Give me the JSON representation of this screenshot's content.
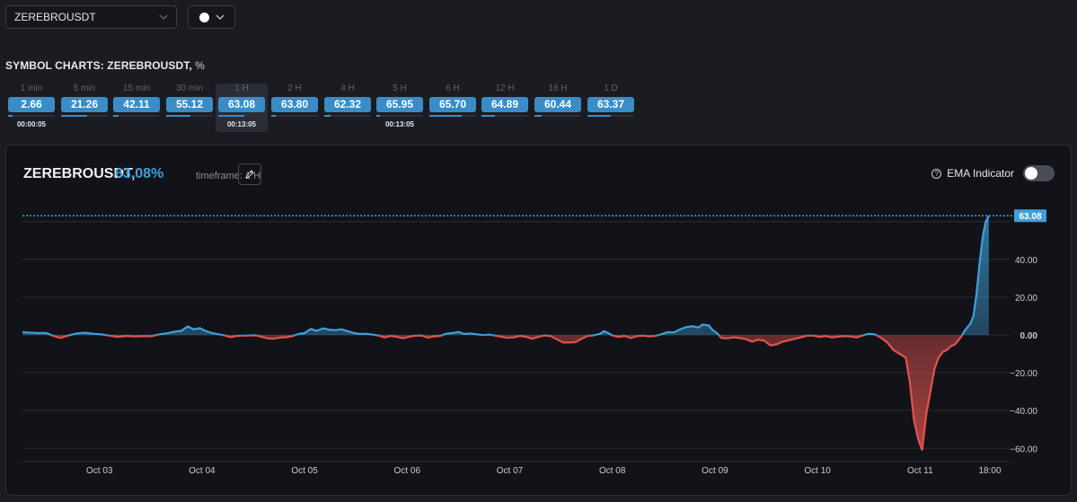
{
  "symbol_select": {
    "value": "ZEREBROUSDT"
  },
  "section": {
    "title": "SYMBOL CHARTS: ZEREBROUSDT,",
    "unit": "%"
  },
  "timeframes": [
    {
      "label": "1 min",
      "value": "2.66",
      "fill": 0.1,
      "timer": "00:00:05",
      "active": false
    },
    {
      "label": "5 min",
      "value": "21.26",
      "fill": 0.55,
      "timer": "",
      "active": false
    },
    {
      "label": "15 min",
      "value": "42.11",
      "fill": 0.12,
      "timer": "",
      "active": false
    },
    {
      "label": "30 min",
      "value": "55.12",
      "fill": 0.52,
      "timer": "",
      "active": false
    },
    {
      "label": "1 H",
      "value": "63.08",
      "fill": 0.55,
      "timer": "00:13:05",
      "active": true
    },
    {
      "label": "2 H",
      "value": "63.80",
      "fill": 0.1,
      "timer": "",
      "active": false
    },
    {
      "label": "4 H",
      "value": "62.32",
      "fill": 0.14,
      "timer": "",
      "active": false
    },
    {
      "label": "5 H",
      "value": "65.95",
      "fill": 0.08,
      "timer": "00:13:05",
      "active": false
    },
    {
      "label": "6 H",
      "value": "65.70",
      "fill": 0.7,
      "timer": "",
      "active": false
    },
    {
      "label": "12 H",
      "value": "64.89",
      "fill": 0.28,
      "timer": "",
      "active": false
    },
    {
      "label": "16 H",
      "value": "60.44",
      "fill": 0.16,
      "timer": "",
      "active": false
    },
    {
      "label": "1 D",
      "value": "63.37",
      "fill": 0.5,
      "timer": "",
      "active": false
    }
  ],
  "panel": {
    "symbol": "ZEREBROUSDT,",
    "value": "63.08%",
    "timeframe": "timeframe: 1 H",
    "ema_label": "EMA Indicator",
    "ema_on": false
  },
  "icons": {
    "chevron": "chevron-down-icon",
    "pencil": "pencil-icon",
    "help": "help-icon"
  },
  "colors": {
    "positive": "#3ea0dc",
    "negative": "#e0534f",
    "accent": "#3a8cc6"
  },
  "chart_data": {
    "type": "area",
    "ylim": [
      -67,
      67
    ],
    "ytick_values": [
      40,
      20,
      0,
      -20,
      -40,
      -60
    ],
    "ytick_labels": [
      "40.00",
      "20.00",
      "0.00",
      "−20.00",
      "−40.00",
      "−60.00"
    ],
    "xlim": [
      2.25,
      11.75
    ],
    "xticks": [
      3,
      4,
      5,
      6,
      7,
      8,
      9,
      10,
      11,
      11.68
    ],
    "xtick_labels": [
      "Oct 03",
      "Oct 04",
      "Oct 05",
      "Oct 06",
      "Oct 07",
      "Oct 08",
      "Oct 09",
      "Oct 10",
      "Oct 11",
      "18:00"
    ],
    "last_value": 63.08,
    "last_label": "63.08",
    "series": [
      {
        "values": [
          [
            2.25,
            1.5
          ],
          [
            2.33,
            1.2
          ],
          [
            2.41,
            1.0
          ],
          [
            2.48,
            1.1
          ],
          [
            2.55,
            -0.5
          ],
          [
            2.62,
            -1.5
          ],
          [
            2.7,
            -0.3
          ],
          [
            2.78,
            0.8
          ],
          [
            2.86,
            1.2
          ],
          [
            2.94,
            0.6
          ],
          [
            3.02,
            0.3
          ],
          [
            3.1,
            -0.4
          ],
          [
            3.18,
            -1.0
          ],
          [
            3.26,
            -0.5
          ],
          [
            3.34,
            -0.8
          ],
          [
            3.42,
            -0.6
          ],
          [
            3.5,
            -0.7
          ],
          [
            3.58,
            0.3
          ],
          [
            3.66,
            0.9
          ],
          [
            3.74,
            1.8
          ],
          [
            3.8,
            2.2
          ],
          [
            3.86,
            4.5
          ],
          [
            3.92,
            3.0
          ],
          [
            3.98,
            3.6
          ],
          [
            4.04,
            2.0
          ],
          [
            4.1,
            1.0
          ],
          [
            4.16,
            0.4
          ],
          [
            4.22,
            -0.3
          ],
          [
            4.28,
            -1.2
          ],
          [
            4.34,
            -0.5
          ],
          [
            4.4,
            -0.4
          ],
          [
            4.46,
            -0.3
          ],
          [
            4.52,
            -0.2
          ],
          [
            4.58,
            -1.0
          ],
          [
            4.64,
            -1.8
          ],
          [
            4.7,
            -2.0
          ],
          [
            4.76,
            -1.4
          ],
          [
            4.82,
            -1.2
          ],
          [
            4.88,
            -0.6
          ],
          [
            4.94,
            0.5
          ],
          [
            5.0,
            1.0
          ],
          [
            5.06,
            3.2
          ],
          [
            5.12,
            2.2
          ],
          [
            5.18,
            3.5
          ],
          [
            5.24,
            2.8
          ],
          [
            5.3,
            2.5
          ],
          [
            5.36,
            3.0
          ],
          [
            5.42,
            2.0
          ],
          [
            5.48,
            1.0
          ],
          [
            5.54,
            0.5
          ],
          [
            5.6,
            0.6
          ],
          [
            5.66,
            0.2
          ],
          [
            5.72,
            -0.3
          ],
          [
            5.78,
            -1.3
          ],
          [
            5.84,
            -0.5
          ],
          [
            5.9,
            -1.0
          ],
          [
            5.96,
            -1.7
          ],
          [
            6.02,
            -1.0
          ],
          [
            6.08,
            -0.4
          ],
          [
            6.14,
            -0.3
          ],
          [
            6.2,
            -1.4
          ],
          [
            6.26,
            -0.7
          ],
          [
            6.32,
            -0.5
          ],
          [
            6.38,
            0.6
          ],
          [
            6.44,
            1.0
          ],
          [
            6.5,
            1.6
          ],
          [
            6.56,
            0.5
          ],
          [
            6.62,
            0.8
          ],
          [
            6.68,
            0.3
          ],
          [
            6.74,
            -0.1
          ],
          [
            6.8,
            0.2
          ],
          [
            6.86,
            -0.4
          ],
          [
            6.92,
            -1.0
          ],
          [
            6.98,
            -1.5
          ],
          [
            7.04,
            -1.3
          ],
          [
            7.1,
            -0.5
          ],
          [
            7.16,
            -1.0
          ],
          [
            7.22,
            -2.0
          ],
          [
            7.28,
            -1.0
          ],
          [
            7.34,
            -0.3
          ],
          [
            7.4,
            -0.6
          ],
          [
            7.46,
            -2.3
          ],
          [
            7.52,
            -4.0
          ],
          [
            7.58,
            -4.0
          ],
          [
            7.64,
            -3.8
          ],
          [
            7.7,
            -2.0
          ],
          [
            7.76,
            -0.5
          ],
          [
            7.82,
            -0.2
          ],
          [
            7.88,
            0.6
          ],
          [
            7.92,
            2.0
          ],
          [
            7.96,
            1.0
          ],
          [
            8.0,
            -0.3
          ],
          [
            8.06,
            -1.0
          ],
          [
            8.12,
            -0.5
          ],
          [
            8.18,
            -1.6
          ],
          [
            8.24,
            -0.6
          ],
          [
            8.3,
            -0.4
          ],
          [
            8.36,
            -0.8
          ],
          [
            8.42,
            -0.5
          ],
          [
            8.48,
            0.4
          ],
          [
            8.54,
            1.5
          ],
          [
            8.6,
            1.4
          ],
          [
            8.66,
            3.0
          ],
          [
            8.72,
            4.2
          ],
          [
            8.78,
            4.6
          ],
          [
            8.84,
            4.0
          ],
          [
            8.88,
            5.5
          ],
          [
            8.94,
            5.0
          ],
          [
            8.98,
            2.5
          ],
          [
            9.02,
            1.0
          ],
          [
            9.06,
            -1.5
          ],
          [
            9.12,
            -1.8
          ],
          [
            9.18,
            -1.3
          ],
          [
            9.24,
            -1.6
          ],
          [
            9.3,
            -2.2
          ],
          [
            9.36,
            -3.5
          ],
          [
            9.42,
            -2.5
          ],
          [
            9.48,
            -3.0
          ],
          [
            9.54,
            -5.5
          ],
          [
            9.6,
            -5.0
          ],
          [
            9.66,
            -3.5
          ],
          [
            9.72,
            -2.8
          ],
          [
            9.78,
            -2.0
          ],
          [
            9.84,
            -1.2
          ],
          [
            9.9,
            -0.4
          ],
          [
            9.96,
            -0.4
          ],
          [
            10.02,
            -1.0
          ],
          [
            10.08,
            -0.6
          ],
          [
            10.14,
            -1.3
          ],
          [
            10.2,
            -0.9
          ],
          [
            10.26,
            -0.6
          ],
          [
            10.32,
            -0.8
          ],
          [
            10.38,
            -1.3
          ],
          [
            10.44,
            -0.3
          ],
          [
            10.5,
            0.6
          ],
          [
            10.56,
            0.3
          ],
          [
            10.62,
            -1.5
          ],
          [
            10.68,
            -4.0
          ],
          [
            10.74,
            -8.0
          ],
          [
            10.8,
            -10.0
          ],
          [
            10.86,
            -12.0
          ],
          [
            10.9,
            -25.0
          ],
          [
            10.94,
            -45.0
          ],
          [
            10.98,
            -55.0
          ],
          [
            11.02,
            -61.0
          ],
          [
            11.06,
            -42.0
          ],
          [
            11.1,
            -30.0
          ],
          [
            11.14,
            -18.0
          ],
          [
            11.18,
            -12.0
          ],
          [
            11.22,
            -9.0
          ],
          [
            11.26,
            -8.0
          ],
          [
            11.3,
            -6.0
          ],
          [
            11.34,
            -5.0
          ],
          [
            11.37,
            -3.0
          ],
          [
            11.4,
            -1.0
          ],
          [
            11.43,
            2.0
          ],
          [
            11.46,
            4.0
          ],
          [
            11.49,
            6.0
          ],
          [
            11.52,
            10.0
          ],
          [
            11.55,
            22.0
          ],
          [
            11.58,
            38.0
          ],
          [
            11.61,
            52.0
          ],
          [
            11.64,
            60.0
          ],
          [
            11.67,
            63.08
          ]
        ]
      }
    ]
  }
}
